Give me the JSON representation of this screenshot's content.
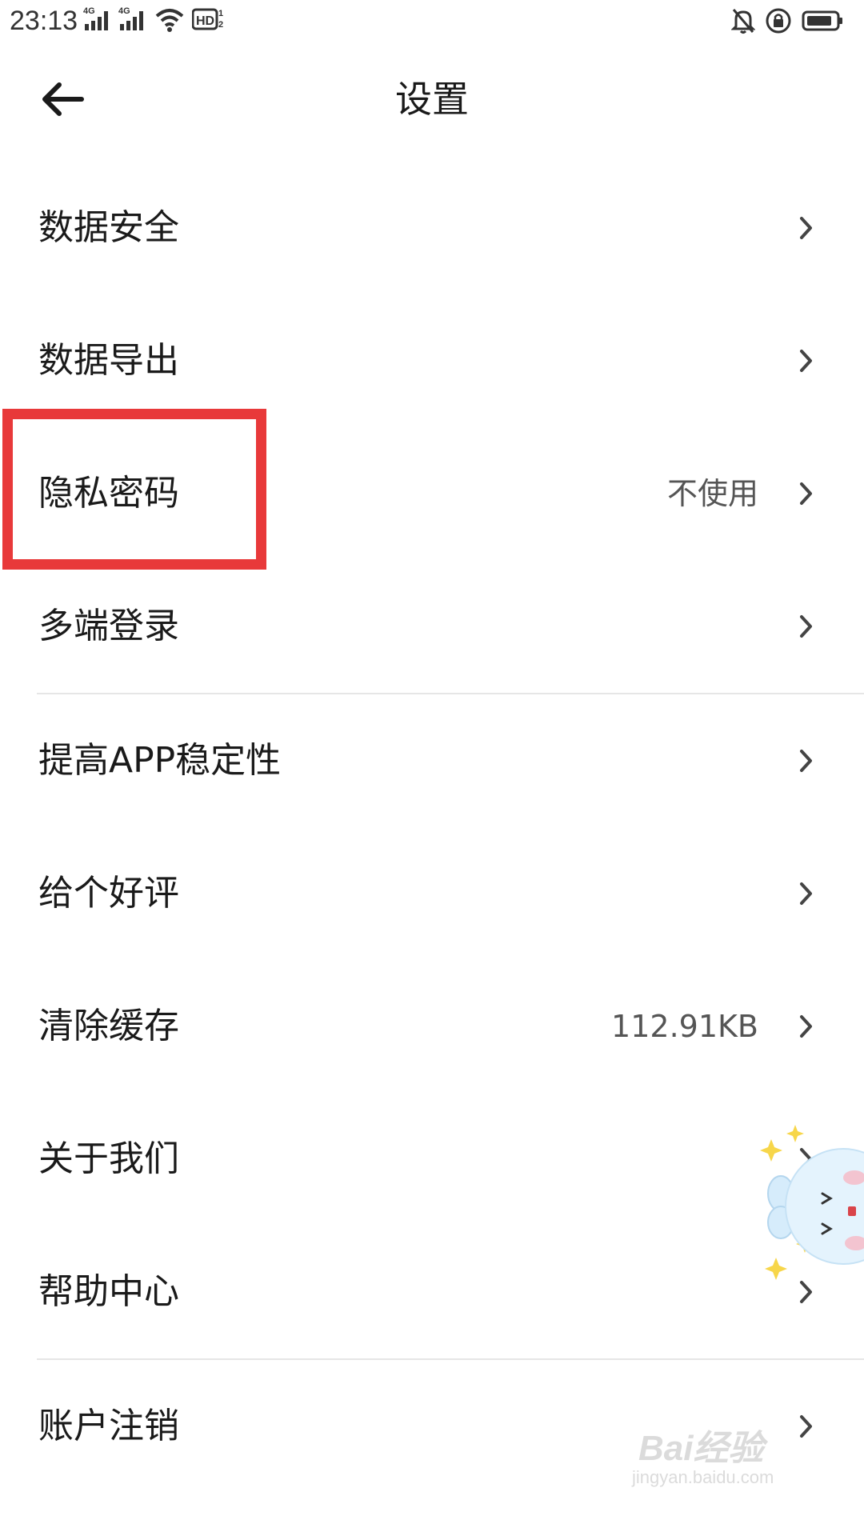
{
  "status_bar": {
    "time": "23:13",
    "network_1": "4G",
    "network_2": "4G",
    "hd_label": "HD",
    "icons": [
      "signal-icon",
      "signal-icon",
      "wifi-icon",
      "hd-icon",
      "bell-muted-icon",
      "rotation-lock-icon",
      "battery-icon"
    ]
  },
  "header": {
    "title": "设置",
    "back_icon": "arrow-left-icon"
  },
  "settings": {
    "items": [
      {
        "label": "数据安全",
        "value": ""
      },
      {
        "label": "数据导出",
        "value": ""
      },
      {
        "label": "隐私密码",
        "value": "不使用"
      },
      {
        "label": "多端登录",
        "value": ""
      },
      {
        "label": "提高APP稳定性",
        "value": ""
      },
      {
        "label": "给个好评",
        "value": ""
      },
      {
        "label": "清除缓存",
        "value": "112.91KB"
      },
      {
        "label": "关于我们",
        "value": ""
      },
      {
        "label": "帮助中心",
        "value": ""
      },
      {
        "label": "账户注销",
        "value": ""
      }
    ]
  },
  "highlight": {
    "color": "#e8393a"
  },
  "watermark": {
    "logo": "Bai经验",
    "url": "jingyan.baidu.com"
  }
}
